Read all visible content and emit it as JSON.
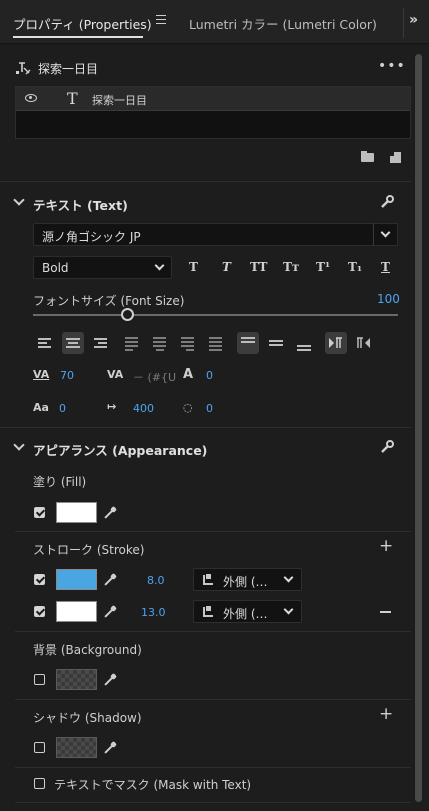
{
  "tabs": {
    "properties": "プロパティ (Properties)",
    "lumetri": "Lumetri カラー (Lumetri Color)",
    "overflow": "»"
  },
  "layer": {
    "title": "探索一日目",
    "more": "•••",
    "item_name": "探索一日目",
    "item_type_glyph": "T"
  },
  "text_section": {
    "title": "テキスト (Text)",
    "font_family": "源ノ角ゴシック JP",
    "font_style": "Bold",
    "style_buttons": [
      "T",
      "T",
      "TT",
      "Tт",
      "T¹",
      "T₁",
      "T"
    ],
    "font_size_label": "フォントサイズ (Font Size)",
    "font_size_value": "100",
    "font_size_slider_fraction": 0.25,
    "tracking_icon": "VA",
    "tracking_value": "70",
    "kerning_icon": "VA",
    "kerning_value": "－ (#{U",
    "leading_icon": "A",
    "leading_value": "0",
    "baseline_icon": "Aa",
    "baseline_value": "0",
    "tsume_icon": "↦",
    "tsume_value": "400",
    "tsume2_icon": "◌",
    "tsume2_value": "0"
  },
  "appearance": {
    "title": "アピアランス (Appearance)",
    "fill_label": "塗り (Fill)",
    "fill_checked": true,
    "fill_color": "#ffffff",
    "stroke_label": "ストローク (Stroke)",
    "strokes": [
      {
        "checked": true,
        "color": "#4aa6e0",
        "width": "8.0",
        "position": "外側 (…"
      },
      {
        "checked": true,
        "color": "#ffffff",
        "width": "13.0",
        "position": "外側 (…"
      }
    ],
    "background_label": "背景 (Background)",
    "background_checked": false,
    "shadow_label": "シャドウ (Shadow)",
    "shadow_checked": false,
    "mask_label": "テキストでマスク (Mask with Text)",
    "mask_checked": false
  },
  "colors": {
    "accent_blue": "#4da3ee",
    "panel_bg": "#1d1d1d"
  }
}
